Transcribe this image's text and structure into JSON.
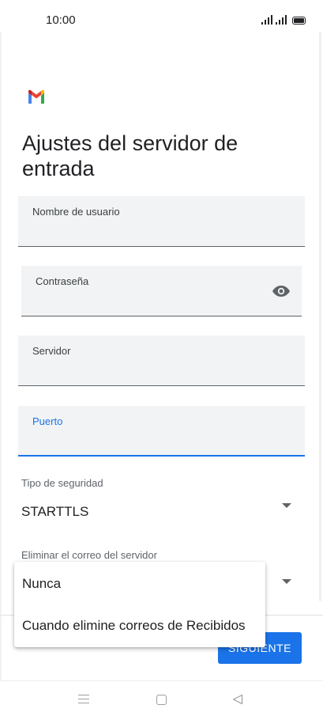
{
  "status_bar": {
    "time": "10:00"
  },
  "header": {
    "logo_icon": "gmail-logo-icon",
    "title": "Ajustes del servidor de entrada"
  },
  "form": {
    "username": {
      "label": "Nombre de usuario",
      "value": ""
    },
    "password": {
      "label": "Contraseña",
      "value": "",
      "toggle_icon": "eye-icon"
    },
    "server": {
      "label": "Servidor",
      "value": ""
    },
    "port": {
      "label": "Puerto",
      "value": ""
    },
    "security_type": {
      "label": "Tipo de seguridad",
      "value": "STARTTLS"
    },
    "delete_from_server": {
      "label": "Eliminar el correo del servidor",
      "value": "Nunca"
    }
  },
  "dropdown_menu": {
    "options": [
      "Nunca",
      "Cuando elimine correos de Recibidos"
    ]
  },
  "footer": {
    "next_label": "SIGUIENTE"
  },
  "nav_bar": {
    "icons": [
      "menu-icon",
      "home-icon",
      "back-icon"
    ]
  },
  "colors": {
    "accent": "#1a73e8",
    "field_background": "#f1f3f4",
    "text_primary": "#202124"
  }
}
